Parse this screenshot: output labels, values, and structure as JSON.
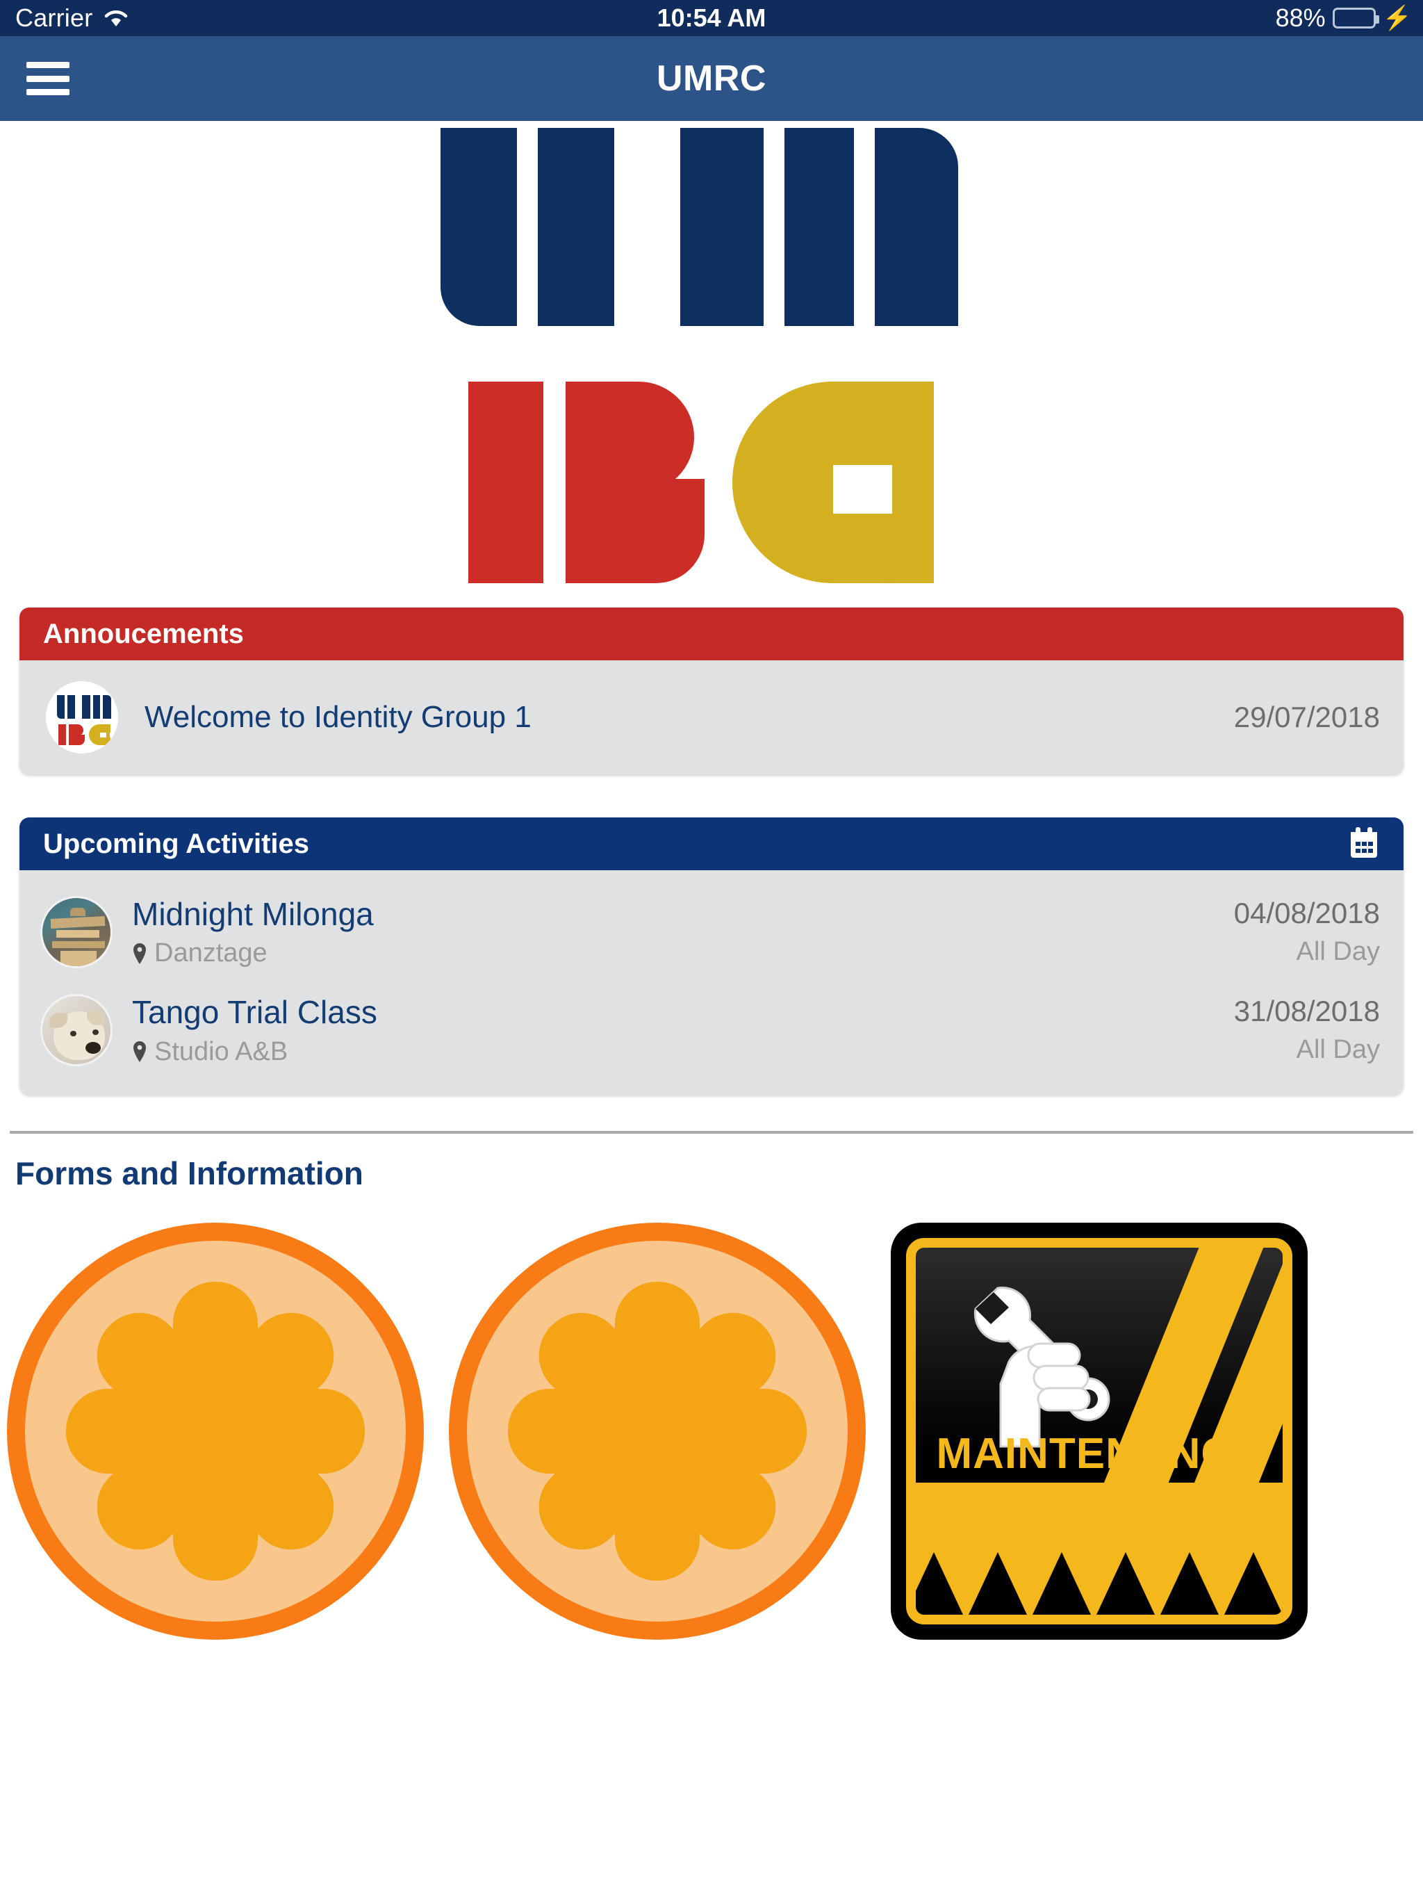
{
  "status_bar": {
    "carrier": "Carrier",
    "wifi_icon": "wifi-icon",
    "time": "10:54 AM",
    "battery_percent": "88%",
    "battery_color": "#4cd964",
    "charging_icon": "lightning-bolt-icon"
  },
  "nav_bar": {
    "title": "UMRC",
    "menu_icon": "hamburger-menu-icon",
    "background": "#2d5489"
  },
  "logo": {
    "name": "umrc-logo",
    "navy": "#0d3060",
    "red": "#cc2d26",
    "gold": "#d4af20"
  },
  "announcements": {
    "header": "Annoucements",
    "header_color": "#c52b26",
    "items": [
      {
        "avatar": "umrc-logo-avatar",
        "title": "Welcome to Identity Group 1",
        "date": "29/07/2018"
      }
    ]
  },
  "upcoming_activities": {
    "header": "Upcoming Activities",
    "header_color": "#0d3476",
    "calendar_icon": "calendar-icon",
    "items": [
      {
        "thumb": "wooden-model-photo",
        "name": "Midnight Milonga",
        "location_icon": "map-pin-icon",
        "location": "Danztage",
        "date": "04/08/2018",
        "time": "All Day"
      },
      {
        "thumb": "dog-photo",
        "name": "Tango Trial Class",
        "location_icon": "map-pin-icon",
        "location": "Studio A&B",
        "date": "31/08/2018",
        "time": "All Day"
      }
    ]
  },
  "forms_and_information": {
    "title": "Forms and Information",
    "title_color": "#123a74",
    "tiles": [
      {
        "icon": "orange-slice-icon",
        "label": ""
      },
      {
        "icon": "orange-slice-icon",
        "label": ""
      },
      {
        "icon": "maintenance-sign-icon",
        "label": "MAINTENANCE"
      }
    ]
  }
}
